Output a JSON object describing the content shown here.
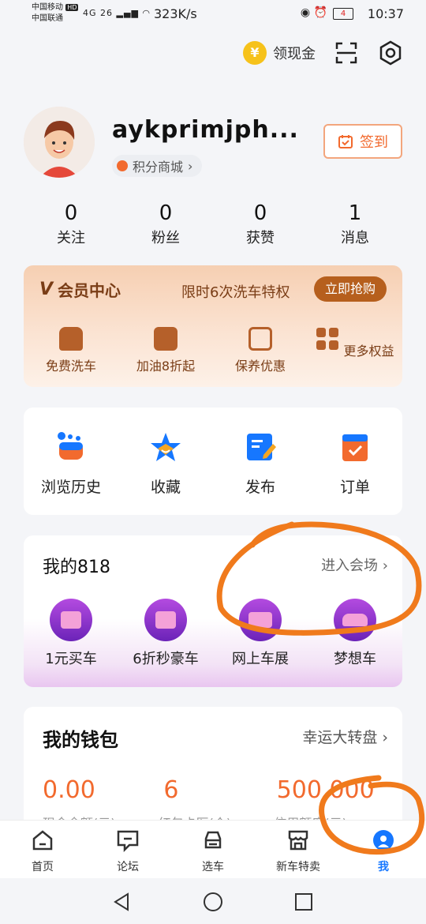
{
  "status_bar": {
    "carrier1": "中国移动",
    "carrier2": "中国联通",
    "hd": "HD",
    "signal": "4G 26",
    "speed": "323K/s",
    "battery": "4",
    "time": "10:37"
  },
  "topbar": {
    "coin_label": "领现金",
    "coin_symbol": "¥"
  },
  "profile": {
    "username": "aykprimjph...",
    "mall_label": "积分商城",
    "checkin_label": "签到"
  },
  "stats": [
    {
      "value": "0",
      "label": "关注"
    },
    {
      "value": "0",
      "label": "粉丝"
    },
    {
      "value": "0",
      "label": "获赞"
    },
    {
      "value": "1",
      "label": "消息"
    }
  ],
  "vip": {
    "badge": "V",
    "title": "会员中心",
    "promo": "限时6次洗车特权",
    "cta": "立即抢购",
    "items": [
      {
        "label": "免费洗车"
      },
      {
        "label": "加油8折起"
      },
      {
        "label": "保养优惠"
      },
      {
        "label": "更多权益"
      }
    ]
  },
  "quick": [
    {
      "label": "浏览历史",
      "icon": "history-icon"
    },
    {
      "label": "收藏",
      "icon": "star-icon"
    },
    {
      "label": "发布",
      "icon": "edit-icon"
    },
    {
      "label": "订单",
      "icon": "order-icon"
    }
  ],
  "my818": {
    "title": "我的818",
    "more": "进入会场",
    "items": [
      {
        "label": "1元买车"
      },
      {
        "label": "6折秒豪车"
      },
      {
        "label": "网上车展"
      },
      {
        "label": "梦想车"
      }
    ]
  },
  "wallet": {
    "title": "我的钱包",
    "more": "幸运大转盘",
    "values": [
      {
        "value": "0.00",
        "sub": "现金余额(元)"
      },
      {
        "value": "6",
        "sub": "红包卡医(个)"
      },
      {
        "value": "500,000",
        "sub": "信用额度(元)"
      }
    ]
  },
  "tabs": [
    {
      "label": "首页",
      "icon": "home-icon"
    },
    {
      "label": "论坛",
      "icon": "forum-icon"
    },
    {
      "label": "选车",
      "icon": "car-icon"
    },
    {
      "label": "新车特卖",
      "icon": "shop-icon"
    },
    {
      "label": "我",
      "icon": "profile-icon"
    }
  ],
  "colors": {
    "accent": "#f26a2e",
    "tab_active": "#1677ff",
    "vip_brown": "#7a3d16",
    "annotation": "#f07a1c"
  }
}
